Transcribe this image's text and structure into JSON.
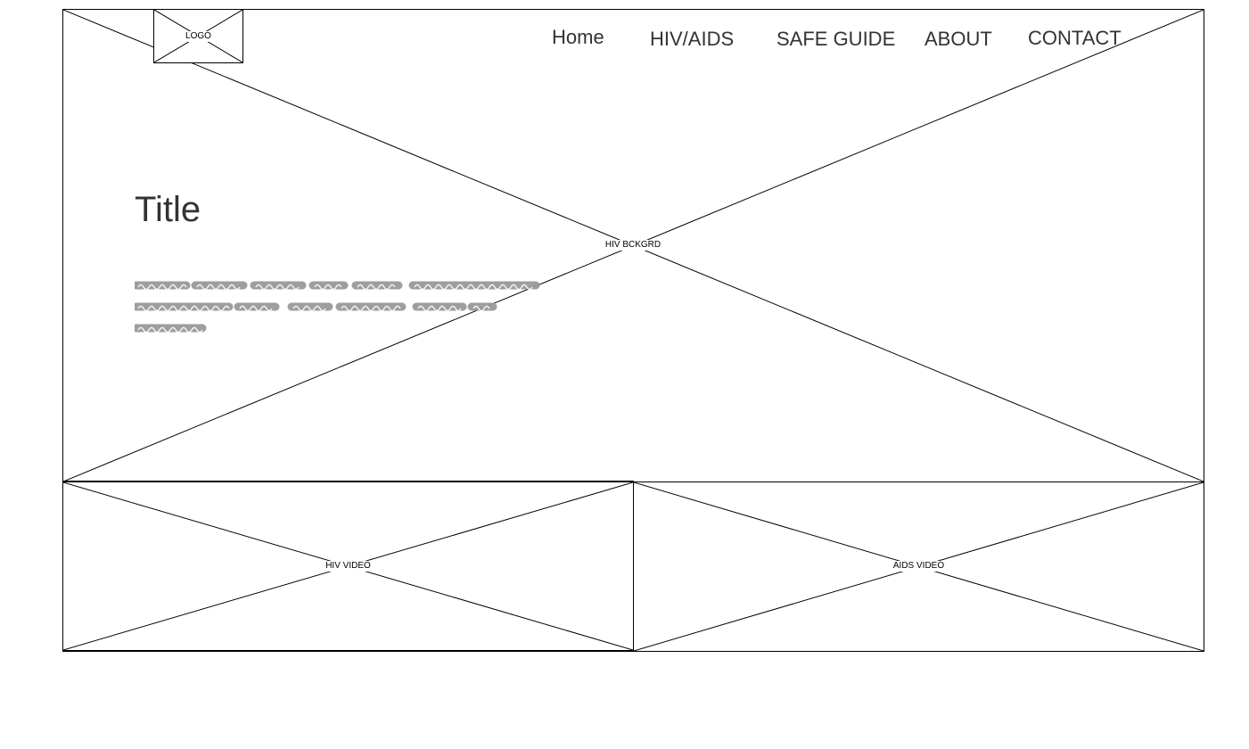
{
  "placeholders": {
    "hero_background": "HIV BCKGRD",
    "logo": "LOGO",
    "hiv_video": "HIV VIDEO",
    "aids_video": "AIDS VIDEO"
  },
  "nav": {
    "home": "Home",
    "hiv_aids": "HIV/AIDS",
    "safe_guide": "SAFE GUIDE",
    "about": "ABOUT",
    "contact": "CONTACT"
  },
  "hero": {
    "title": "Title"
  },
  "colors": {
    "text": "#333333",
    "stroke": "#000000",
    "scribble": "#999999"
  }
}
